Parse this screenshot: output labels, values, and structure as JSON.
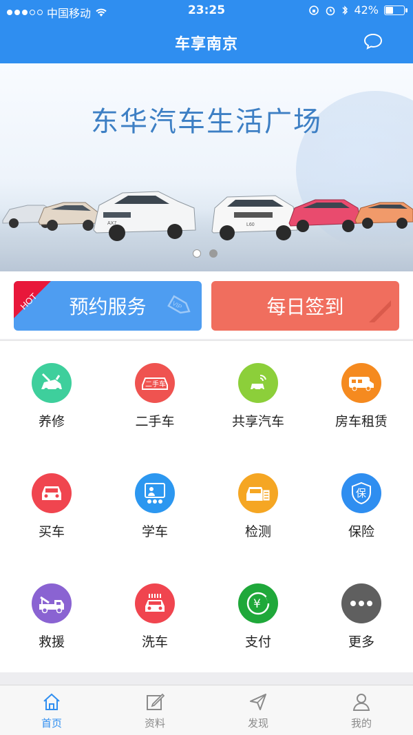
{
  "status_bar": {
    "carrier": "中国移动",
    "time": "23:25",
    "battery": "42%",
    "battery_level": 0.42
  },
  "nav": {
    "title": "车享南京"
  },
  "banner": {
    "title": "东华汽车生活广场",
    "slides": 2,
    "active_slide": 0,
    "car_labels": [
      "AX7",
      "L60"
    ]
  },
  "actions": {
    "book": "预约服务",
    "hot": "HOT",
    "vip": "VIP",
    "sign": "每日签到"
  },
  "services": [
    {
      "label": "养修",
      "color": "#3ecf9c",
      "icon": "repair-icon"
    },
    {
      "label": "二手车",
      "color": "#ef5350",
      "icon": "used-car-icon",
      "badge": "二手车"
    },
    {
      "label": "共享汽车",
      "color": "#8ccf3a",
      "icon": "share-car-icon"
    },
    {
      "label": "房车租赁",
      "color": "#f58a1f",
      "icon": "rv-icon"
    },
    {
      "label": "买车",
      "color": "#f0454f",
      "icon": "buy-car-icon"
    },
    {
      "label": "学车",
      "color": "#2c97f0",
      "icon": "driving-school-icon"
    },
    {
      "label": "检测",
      "color": "#f5a623",
      "icon": "inspection-icon"
    },
    {
      "label": "保险",
      "color": "#2f8ef0",
      "icon": "insurance-icon",
      "badge": "保"
    },
    {
      "label": "救援",
      "color": "#8a63d2",
      "icon": "tow-truck-icon"
    },
    {
      "label": "洗车",
      "color": "#f0454f",
      "icon": "car-wash-icon"
    },
    {
      "label": "支付",
      "color": "#1fa83a",
      "icon": "pay-icon",
      "badge": "¥"
    },
    {
      "label": "更多",
      "color": "#5f5f5f",
      "icon": "more-icon"
    }
  ],
  "tabs": [
    {
      "label": "首页",
      "icon": "home-icon",
      "active": true
    },
    {
      "label": "资料",
      "icon": "edit-icon",
      "active": false
    },
    {
      "label": "发现",
      "icon": "discover-icon",
      "active": false
    },
    {
      "label": "我的",
      "icon": "user-icon",
      "active": false
    }
  ]
}
